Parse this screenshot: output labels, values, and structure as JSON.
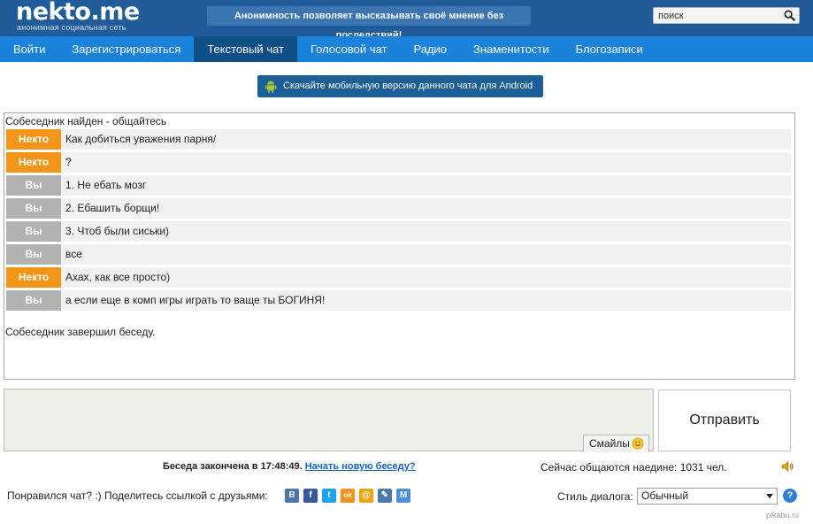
{
  "header": {
    "logo": "nekto.me",
    "logo_sub": "анонимная социальная сеть",
    "slogan": "Анонимность позволяет высказывать своё мнение без последствий!",
    "search_placeholder": "поиск",
    "bg_color": "#1f5c99"
  },
  "nav": {
    "items": [
      {
        "label": "Войти"
      },
      {
        "label": "Зарегистрироваться"
      },
      {
        "label": "Текстовый чат"
      },
      {
        "label": "Голосовой чат"
      },
      {
        "label": "Радио"
      },
      {
        "label": "Знаменитости"
      },
      {
        "label": "Блогозаписи"
      }
    ],
    "active": "Текстовый чат",
    "bg_color": "#1a82d8",
    "active_color": "#0e4f86"
  },
  "android_banner": {
    "label": "Скачайте мобильную версию данного чата для Android",
    "icon": "android-icon"
  },
  "chat": {
    "status": "Собеседник найден - общайтесь",
    "messages": [
      {
        "author": "Некто",
        "role": "nekto",
        "text": "Как добиться уважения парня/"
      },
      {
        "author": "Некто",
        "role": "nekto",
        "text": "?"
      },
      {
        "author": "Вы",
        "role": "vy",
        "text": "1. Не ебать мозг"
      },
      {
        "author": "Вы",
        "role": "vy",
        "text": "2. Ебашить борщи!"
      },
      {
        "author": "Вы",
        "role": "vy",
        "text": "3. Чтоб были сиськи)"
      },
      {
        "author": "Вы",
        "role": "vy",
        "text": "все"
      },
      {
        "author": "Некто",
        "role": "nekto",
        "text": "Ахах, как все просто)"
      },
      {
        "author": "Вы",
        "role": "vy",
        "text": "а если еще в комп игры играть то ваще ты БОГИНЯ!"
      }
    ],
    "end_text": "Собеседник завершил беседу.",
    "nekto_color": "#f59518",
    "vy_color": "#b2b2b2"
  },
  "composer": {
    "smiles_label": "Смайлы",
    "send_label": "Отправить"
  },
  "status_line": {
    "ended_text": "Беседа закончена в 17:48:49.",
    "new_chat_link": "Начать новую беседу?",
    "online_text": "Сейчас общаются наедине: 1031 чел."
  },
  "footer": {
    "share_label": "Понравился чат? :) Поделитесь ссылкой с друзьями:",
    "share_icons": [
      {
        "icon": "vk-icon",
        "glyph": "В",
        "color": "#4a76a8"
      },
      {
        "icon": "facebook-icon",
        "glyph": "f",
        "color": "#3b5998"
      },
      {
        "icon": "twitter-icon",
        "glyph": "t",
        "color": "#1da1f2"
      },
      {
        "icon": "odnoklassniki-icon",
        "glyph": "ok",
        "color": "#f7931e"
      },
      {
        "icon": "mailru-icon",
        "glyph": "@",
        "color": "#f0a30a"
      },
      {
        "icon": "livejournal-icon",
        "glyph": "✎",
        "color": "#4c79a6"
      },
      {
        "icon": "moimir-icon",
        "glyph": "M",
        "color": "#4f8fd4"
      }
    ],
    "style_label": "Стиль диалога:",
    "style_value": "Обычный",
    "help_glyph": "?",
    "watermark": "pikabu.ru"
  }
}
